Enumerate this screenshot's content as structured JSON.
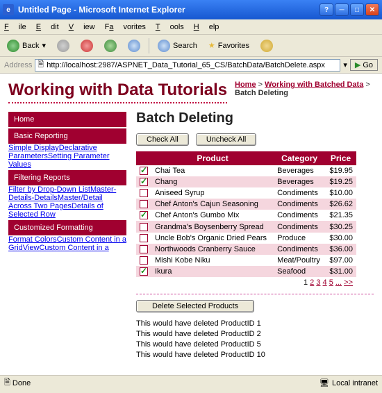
{
  "title": "Untitled Page - Microsoft Internet Explorer",
  "menus": {
    "file": "File",
    "edit": "Edit",
    "view": "View",
    "fav": "Favorites",
    "tools": "Tools",
    "help": "Help"
  },
  "toolbar": {
    "back": "Back",
    "search": "Search",
    "favorites": "Favorites"
  },
  "address": {
    "label": "Address",
    "url": "http://localhost:2987/ASPNET_Data_Tutorial_65_CS/BatchData/BatchDelete.aspx",
    "go": "Go"
  },
  "site_title": "Working with Data Tutorials",
  "breadcrumb": {
    "home": "Home",
    "sep": " > ",
    "l1": "Working with Batched Data",
    "cur": "Batch Deleting"
  },
  "sidebar": [
    {
      "header": "Home",
      "items": []
    },
    {
      "header": "Basic Reporting",
      "items": [
        "Simple Display",
        "Declarative Parameters",
        "Setting Parameter Values"
      ]
    },
    {
      "header": "Filtering Reports",
      "items": [
        "Filter by Drop-Down List",
        "Master-Details-Details",
        "Master/Detail Across Two Pages",
        "Details of Selected Row"
      ]
    },
    {
      "header": "Customized Formatting",
      "items": [
        "Format Colors",
        "Custom Content in a GridView",
        "Custom Content in a"
      ]
    }
  ],
  "main": {
    "heading": "Batch Deleting",
    "check_all": "Check All",
    "uncheck_all": "Uncheck All",
    "cols": {
      "product": "Product",
      "category": "Category",
      "price": "Price"
    },
    "rows": [
      {
        "chk": true,
        "p": "Chai Tea",
        "c": "Beverages",
        "pr": "$19.95",
        "alt": false
      },
      {
        "chk": true,
        "p": "Chang",
        "c": "Beverages",
        "pr": "$19.25",
        "alt": true
      },
      {
        "chk": false,
        "p": "Aniseed Syrup",
        "c": "Condiments",
        "pr": "$10.00",
        "alt": false
      },
      {
        "chk": false,
        "p": "Chef Anton's Cajun Seasoning",
        "c": "Condiments",
        "pr": "$26.62",
        "alt": true
      },
      {
        "chk": true,
        "p": "Chef Anton's Gumbo Mix",
        "c": "Condiments",
        "pr": "$21.35",
        "alt": false
      },
      {
        "chk": false,
        "p": "Grandma's Boysenberry Spread",
        "c": "Condiments",
        "pr": "$30.25",
        "alt": true
      },
      {
        "chk": false,
        "p": "Uncle Bob's Organic Dried Pears",
        "c": "Produce",
        "pr": "$30.00",
        "alt": false
      },
      {
        "chk": false,
        "p": "Northwoods Cranberry Sauce",
        "c": "Condiments",
        "pr": "$36.00",
        "alt": true
      },
      {
        "chk": false,
        "p": "Mishi Kobe Niku",
        "c": "Meat/Poultry",
        "pr": "$97.00",
        "alt": false
      },
      {
        "chk": true,
        "p": "Ikura",
        "c": "Seafood",
        "pr": "$31.00",
        "alt": true
      }
    ],
    "pager": {
      "cur": "1",
      "links": [
        "2",
        "3",
        "4",
        "5",
        "...",
        ">>"
      ]
    },
    "delete_btn": "Delete Selected Products",
    "results": [
      "This would have deleted ProductID 1",
      "This would have deleted ProductID 2",
      "This would have deleted ProductID 5",
      "This would have deleted ProductID 10"
    ]
  },
  "status": {
    "done": "Done",
    "zone": "Local intranet"
  }
}
